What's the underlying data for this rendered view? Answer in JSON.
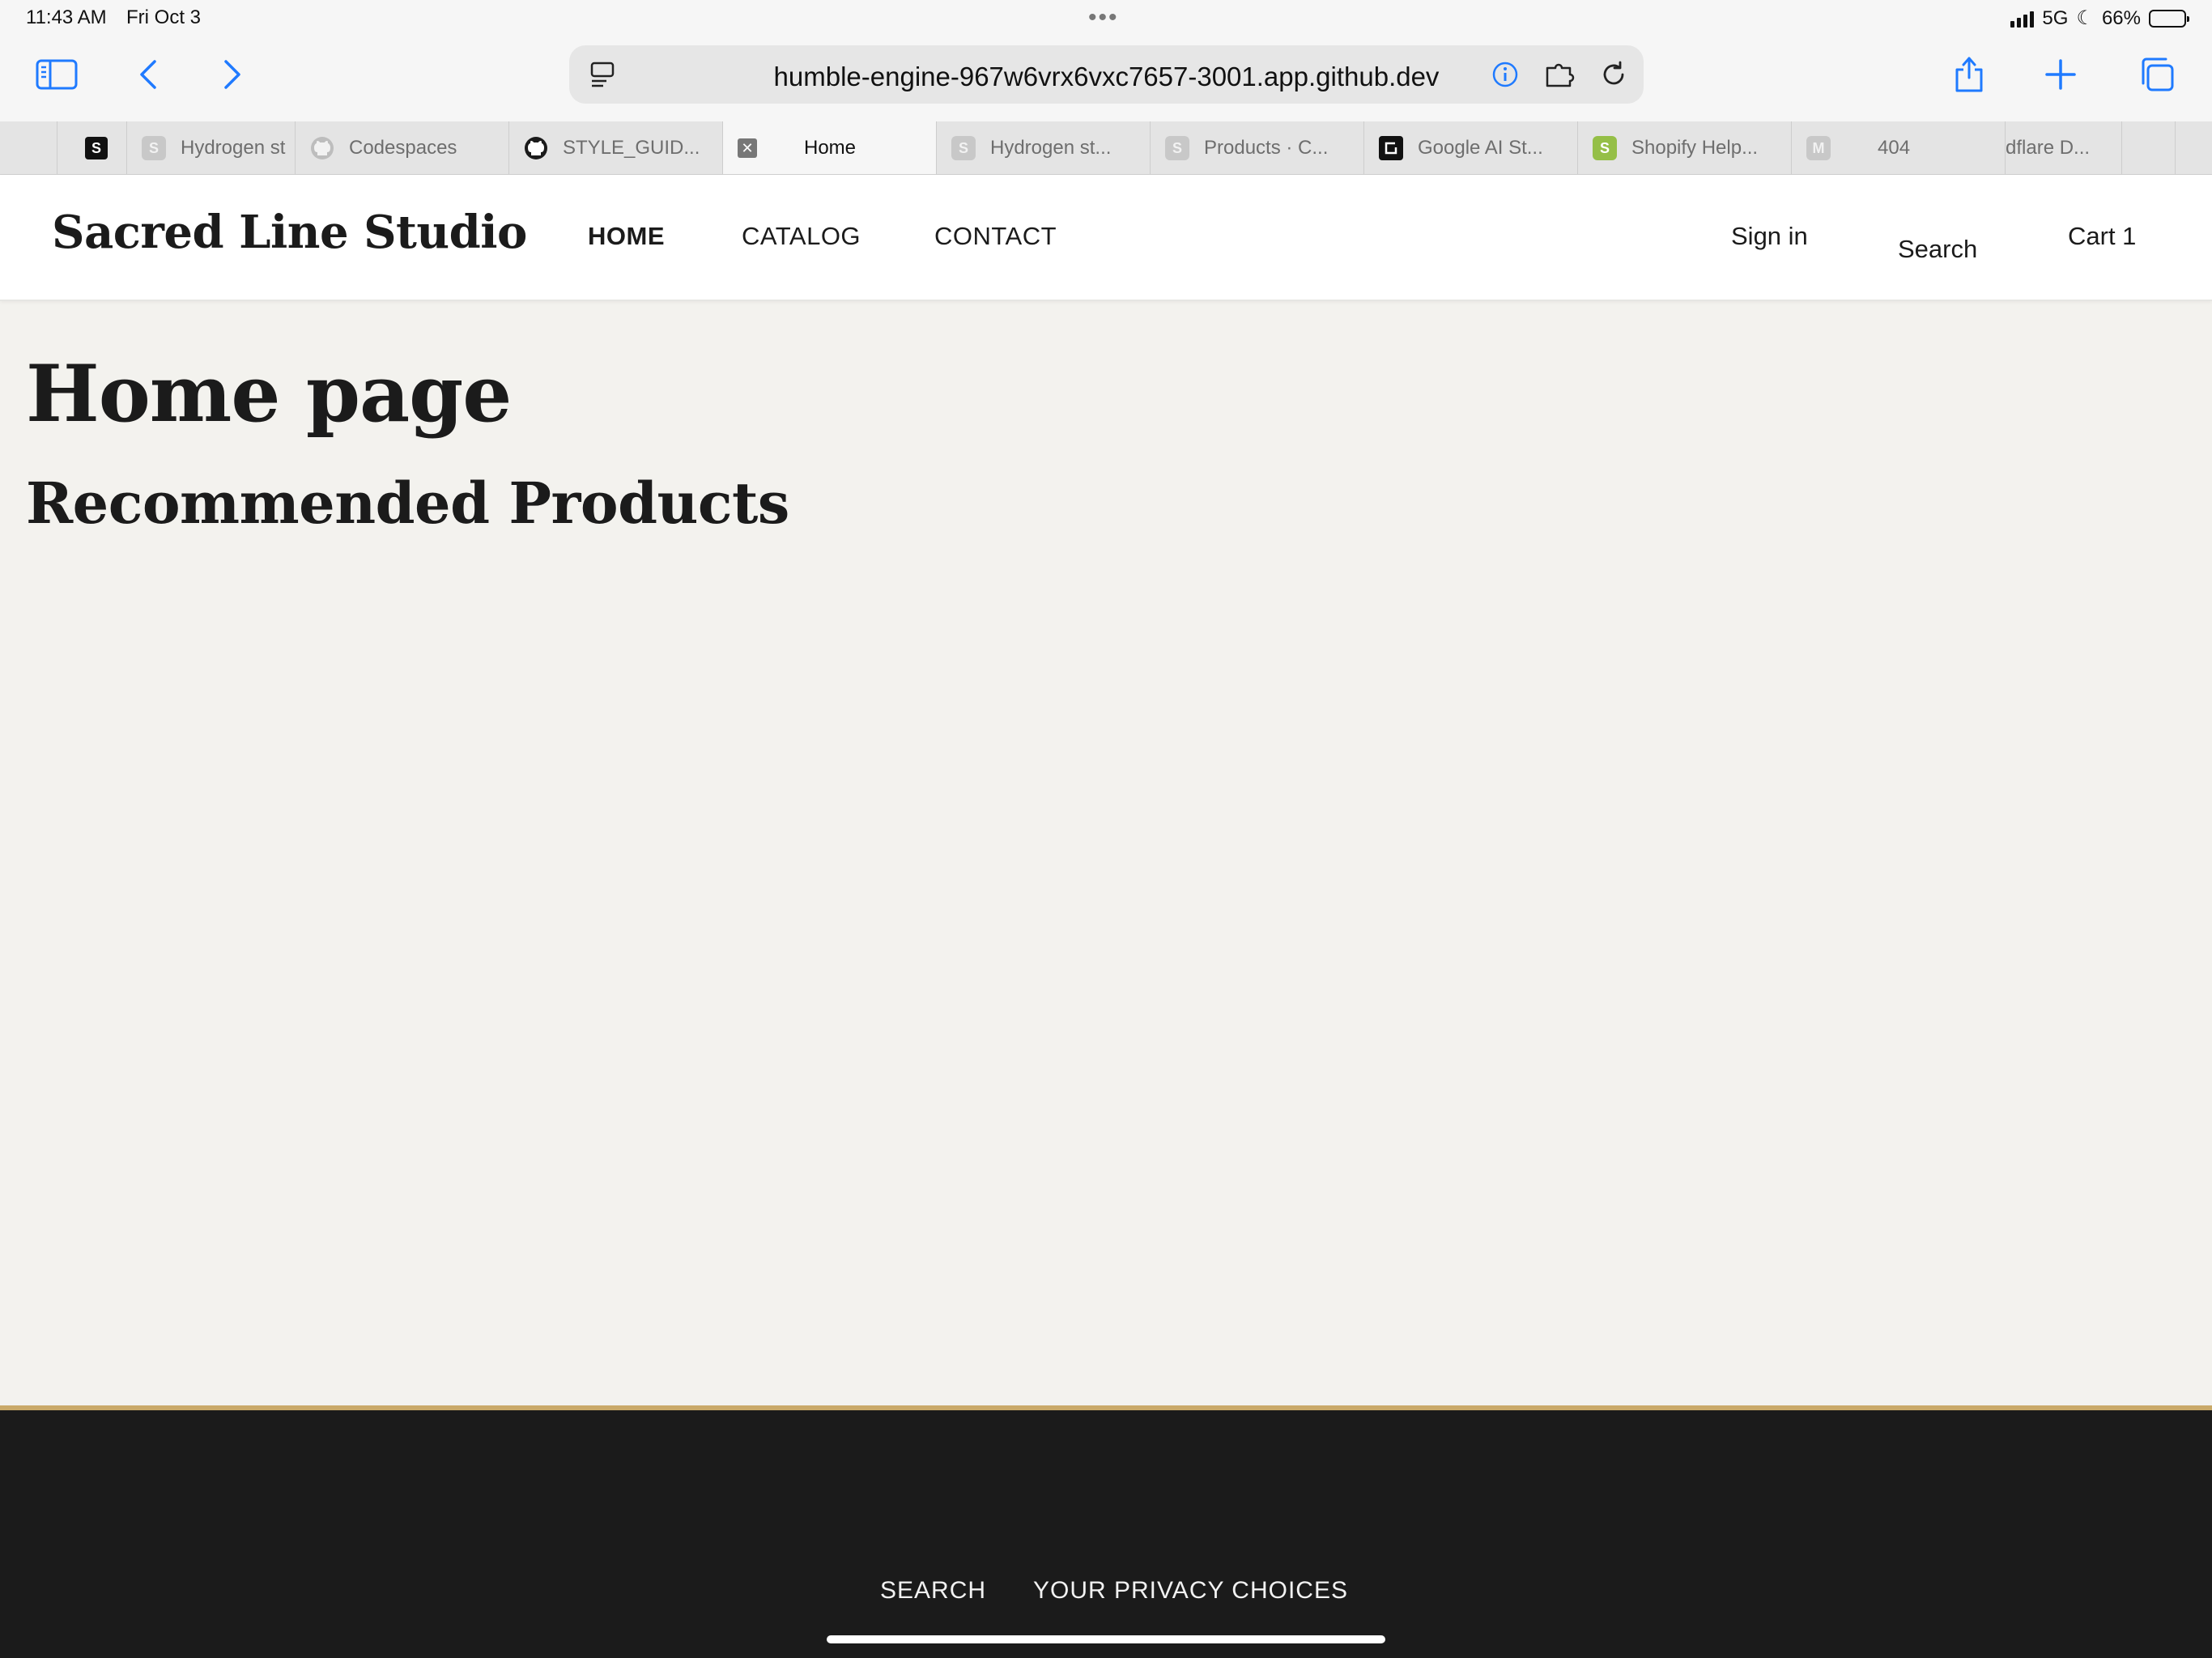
{
  "status_bar": {
    "time": "11:43 AM",
    "date": "Fri Oct 3",
    "network": "5G",
    "battery": "66%",
    "battery_level": 0.66
  },
  "browser": {
    "url": "humble-engine-967w6vrx6vxc7657-3001.app.github.dev",
    "accent_color": "#1f7aff",
    "tabs": [
      {
        "label": "",
        "icon": "shopify-bag-icon"
      },
      {
        "label": "Hydrogen st",
        "icon": "s-letter-icon"
      },
      {
        "label": "Codespaces",
        "icon": "github-icon"
      },
      {
        "label": "STYLE_GUID...",
        "icon": "github-icon"
      },
      {
        "label": "Home",
        "icon": "close-icon",
        "active": true
      },
      {
        "label": "Hydrogen st...",
        "icon": "s-letter-icon"
      },
      {
        "label": "Products · C...",
        "icon": "s-letter-icon"
      },
      {
        "label": "Google AI St...",
        "icon": "google-ai-studio-icon"
      },
      {
        "label": "Shopify Help...",
        "icon": "shopify-bag-icon"
      },
      {
        "label": "404",
        "icon": "m-letter-icon"
      },
      {
        "label": "dflare D...",
        "icon": ""
      }
    ]
  },
  "site": {
    "logo": "Sacred Line Studio",
    "nav": {
      "home": "HOME",
      "catalog": "CATALOG",
      "contact": "CONTACT"
    },
    "actions": {
      "sign_in": "Sign in",
      "search": "Search",
      "cart": "Cart 1"
    }
  },
  "main": {
    "title": "Home page",
    "section_title": "Recommended Products"
  },
  "footer": {
    "search": "SEARCH",
    "privacy": "YOUR PRIVACY CHOICES",
    "background_color": "#1b1b1b",
    "accent_border_color": "#c9a968"
  }
}
